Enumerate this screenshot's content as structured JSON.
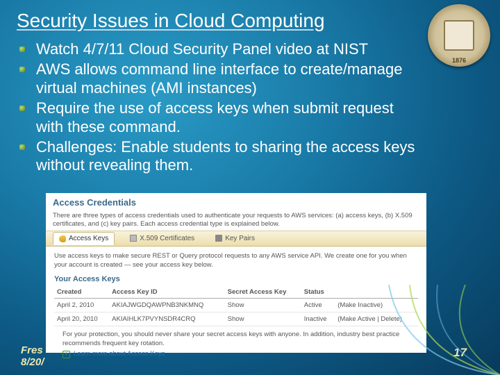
{
  "title": "Security Issues in Cloud Computing",
  "seal": {
    "year": "1876"
  },
  "bullets": [
    "Watch 4/7/11 Cloud Security Panel video at NIST",
    "AWS allows command line interface to create/manage virtual machines (AMI instances)",
    "Require the use of access keys when submit request with these command.",
    "Challenges: Enable students to sharing the access keys without revealing them."
  ],
  "screenshot": {
    "heading": "Access Credentials",
    "intro": "There are three types of access credentials used to authenticate your requests to AWS services: (a) access keys, (b) X.509 certificates, and (c) key pairs. Each access credential type is explained below.",
    "tabs": [
      {
        "label": "Access Keys",
        "active": true
      },
      {
        "label": "X.509 Certificates",
        "active": false
      },
      {
        "label": "Key Pairs",
        "active": false
      }
    ],
    "body_text": "Use access keys to make secure REST or Query protocol requests to any AWS service API. We create one for you when your account is created — see your access key below.",
    "subheading": "Your Access Keys",
    "columns": [
      "Created",
      "Access Key ID",
      "Secret Access Key",
      "Status",
      ""
    ],
    "rows": [
      {
        "created": "April 2, 2010",
        "id": "AKIAJWGDQAWPNB3NKMNQ",
        "secret": "Show",
        "status": "Active",
        "actions": "(Make Inactive)"
      },
      {
        "created": "April 20, 2010",
        "id": "AKIAIHLK7PVYNSDR4CRQ",
        "secret": "Show",
        "status": "Inactive",
        "actions": "(Make Active | Delete)"
      }
    ],
    "protection": "For your protection, you should never share your secret access keys with anyone. In addition, industry best practice recommends frequent key rotation.",
    "learn_more": "Learn more about Access Keys"
  },
  "footer": {
    "left_line1": "Fres",
    "left_line2": "8/20/",
    "page": "17"
  }
}
